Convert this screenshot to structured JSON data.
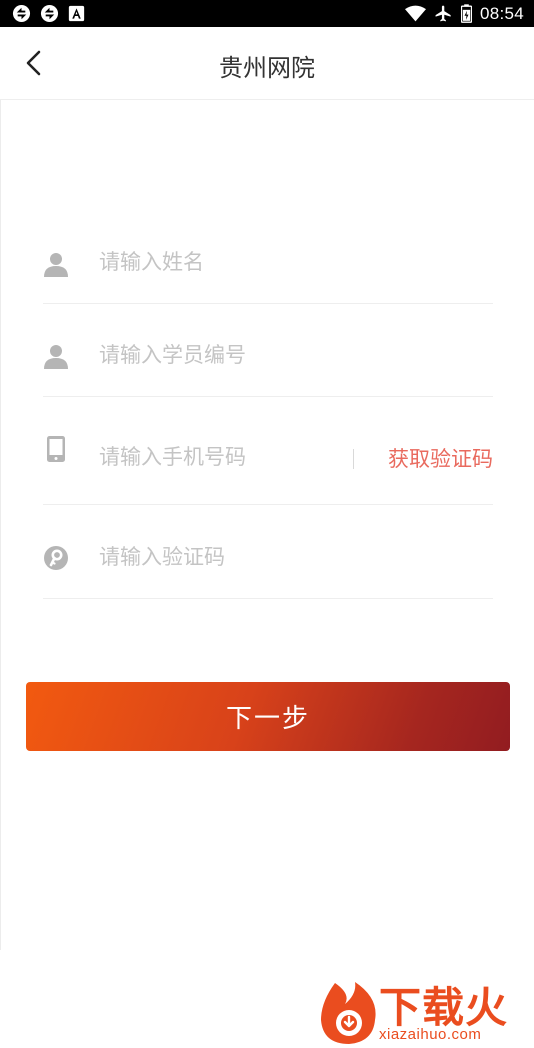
{
  "status_bar": {
    "time": "08:54",
    "left_icons": [
      "sync-icon",
      "sync-icon",
      "text-a-icon"
    ],
    "right_icons": [
      "wifi-icon",
      "airplane-icon",
      "battery-icon"
    ]
  },
  "header": {
    "title": "贵州网院",
    "back_icon": "chevron-left-icon"
  },
  "form": {
    "name_placeholder": "请输入姓名",
    "student_id_placeholder": "请输入学员编号",
    "phone_placeholder": "请输入手机号码",
    "get_code_label": "获取验证码",
    "code_placeholder": "请输入验证码",
    "next_label": "下一步"
  },
  "watermark": {
    "name": "下载火",
    "url": "xiazaihuo.com"
  },
  "colors": {
    "accent_link": "#e96a5e",
    "button_gradient_start": "#f25a10",
    "button_gradient_end": "#921c20",
    "placeholder": "#c4c4c4",
    "icon_gray": "#b5b5b5"
  }
}
